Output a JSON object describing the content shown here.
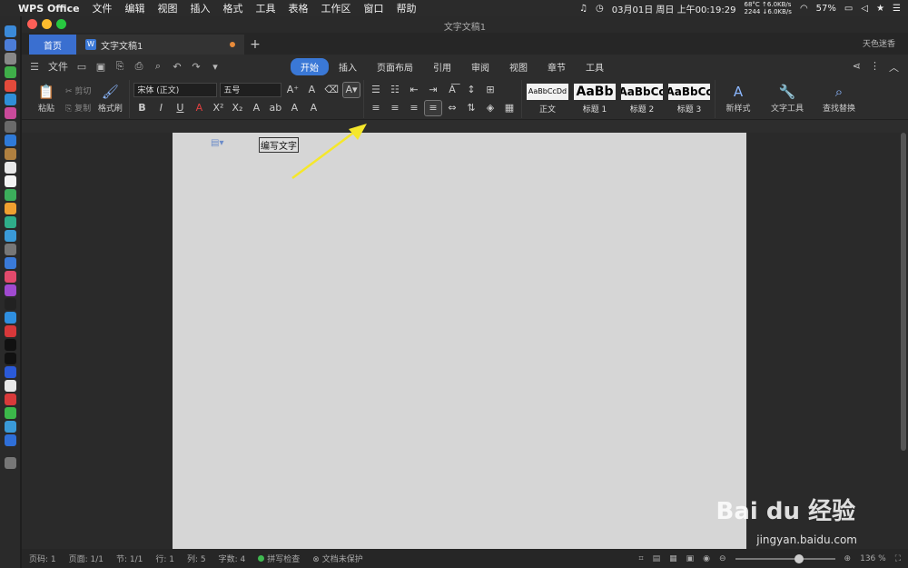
{
  "menubar": {
    "app": "WPS Office",
    "items": [
      "文件",
      "编辑",
      "视图",
      "插入",
      "格式",
      "工具",
      "表格",
      "工作区",
      "窗口",
      "帮助"
    ],
    "date": "03月01日 周日 上午00:19:29",
    "temp": "68°C ↑6.0KB/s",
    "temp2": "2244 ↓6.0KB/s",
    "battery": "57%"
  },
  "window": {
    "title": "文字文稿1"
  },
  "tabs": {
    "home": "首页",
    "doc": "文字文稿1",
    "plus": "+",
    "user": "天色迷香"
  },
  "menurow": {
    "file": "文件",
    "tabs": [
      "开始",
      "插入",
      "页面布局",
      "引用",
      "审阅",
      "视图",
      "章节",
      "工具"
    ]
  },
  "ribbon": {
    "paste": "粘贴",
    "cut": "剪切",
    "copy": "复制",
    "formatPainter": "格式刷",
    "font": "宋体 (正文)",
    "size": "五号",
    "styles": [
      {
        "preview": "AaBbCcDd",
        "name": "正文"
      },
      {
        "preview": "AaBb",
        "name": "标题 1"
      },
      {
        "preview": "AaBbCc",
        "name": "标题 2"
      },
      {
        "preview": "AaBbCc",
        "name": "标题 3"
      }
    ],
    "newStyle": "新样式",
    "textTools": "文字工具",
    "findReplace": "查找替换"
  },
  "document": {
    "text": "编写文字"
  },
  "status": {
    "page": "页码: 1",
    "pages": "页面: 1/1",
    "section": "节: 1/1",
    "line": "行: 1",
    "col": "列: 5",
    "words": "字数: 4",
    "spell": "拼写检查",
    "protect": "文档未保护",
    "zoom": "136 %"
  },
  "watermark": {
    "brand": "Bai du 经验",
    "url": "jingyan.baidu.com"
  },
  "colors": {
    "accent": "#3a78d6",
    "arrow": "#f5e72b"
  }
}
